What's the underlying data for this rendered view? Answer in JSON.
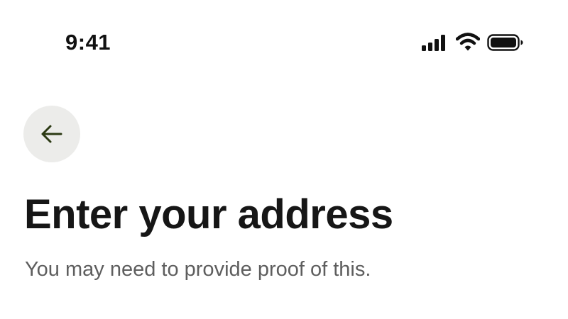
{
  "status_bar": {
    "time": "9:41",
    "icons": [
      "cellular-signal-icon",
      "wifi-icon",
      "battery-icon"
    ]
  },
  "navigation": {
    "back_icon": "arrow-left-icon"
  },
  "header": {
    "title": "Enter your address",
    "subtitle": "You may need to provide proof of this."
  },
  "colors": {
    "background": "#ffffff",
    "title_text": "#161616",
    "subtitle_text": "#5e5e5e",
    "back_button_bg": "#ececea",
    "back_arrow": "#2c3a14"
  }
}
